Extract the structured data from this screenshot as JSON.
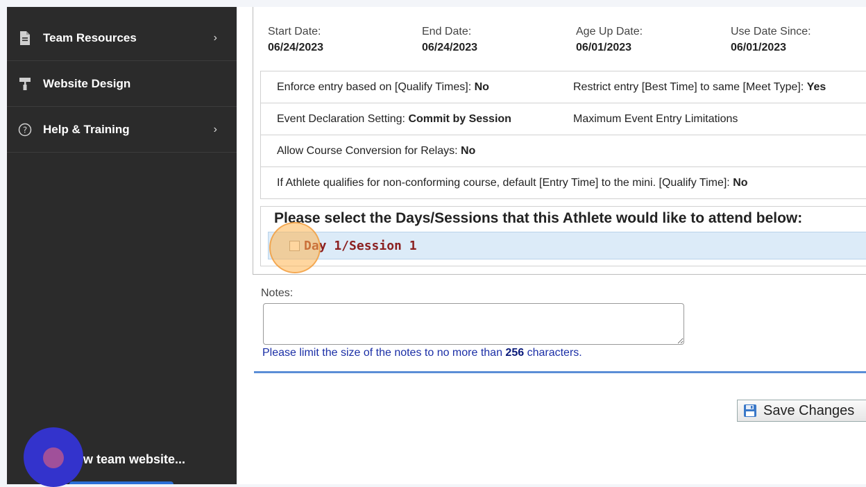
{
  "sidebar": {
    "items": [
      {
        "label": "Team Resources",
        "icon": "document-icon",
        "chevron": "›"
      },
      {
        "label": "Website Design",
        "icon": "paint-roller-icon",
        "chevron": ""
      },
      {
        "label": "Help & Training",
        "icon": "help-circle-icon",
        "chevron": "›"
      }
    ],
    "view_site_label": "ew team website..."
  },
  "dates": {
    "start": {
      "label": "Start Date:",
      "value": "06/24/2023"
    },
    "end": {
      "label": "End Date:",
      "value": "06/24/2023"
    },
    "age_up": {
      "label": "Age Up Date:",
      "value": "06/01/2023"
    },
    "use_since": {
      "label": "Use Date Since:",
      "value": "06/01/2023"
    }
  },
  "settings": {
    "enforce_label": "Enforce entry based on [Qualify Times]:",
    "enforce_value": "No",
    "restrict_label": "Restrict entry [Best Time] to same [Meet Type]:",
    "restrict_value": "Yes",
    "declaration_label": "Event Declaration Setting:",
    "declaration_value": "Commit by Session",
    "max_limits_label": "Maximum Event Entry Limitations",
    "course_conv_label": "Allow Course Conversion for Relays:",
    "course_conv_value": "No",
    "nonconf_label": "If Athlete qualifies for non-conforming course, default [Entry Time] to the mini. [Qualify Time]:",
    "nonconf_value": "No"
  },
  "sessions": {
    "heading": "Please select the Days/Sessions that this Athlete would like to attend below:",
    "items": [
      {
        "label": "Day 1/Session 1",
        "checked": false
      }
    ]
  },
  "notes": {
    "label": "Notes:",
    "value": "",
    "limit_prefix": "Please limit the size of the notes to no more than",
    "limit_count": "256",
    "limit_suffix": "characters."
  },
  "actions": {
    "save_label": "Save Changes"
  },
  "colors": {
    "sidebar_bg": "#2b2b2b",
    "session_label": "#8b1f1f",
    "divider": "#5b8ed6",
    "limit_text": "#1a2ea6"
  }
}
